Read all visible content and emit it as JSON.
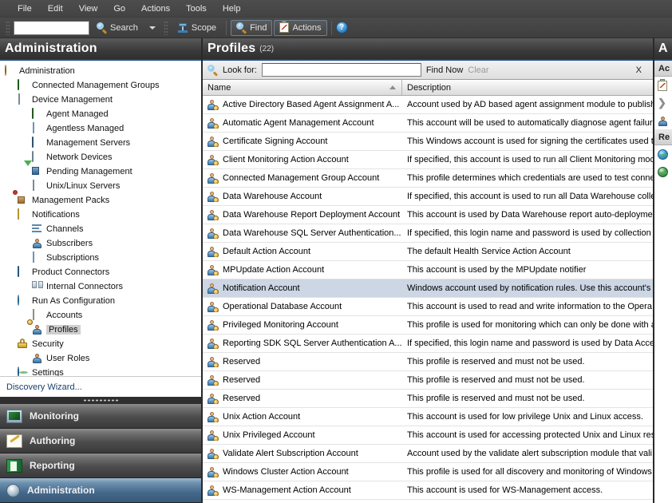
{
  "window": {
    "menu": [
      "File",
      "Edit",
      "View",
      "Go",
      "Actions",
      "Tools",
      "Help"
    ]
  },
  "toolbar": {
    "search_value": "",
    "search_placeholder": "",
    "search_label": "Search",
    "scope_label": "Scope",
    "find_label": "Find",
    "actions_label": "Actions",
    "help_label": "?"
  },
  "sidebar": {
    "title": "Administration",
    "tree": [
      {
        "label": "Administration",
        "indent": 0,
        "icon": "gear-icon",
        "selected": false
      },
      {
        "label": "Connected Management Groups",
        "indent": 1,
        "icon": "connected-groups-icon",
        "selected": false
      },
      {
        "label": "Device Management",
        "indent": 1,
        "icon": "device-management-icon",
        "selected": false
      },
      {
        "label": "Agent Managed",
        "indent": 2,
        "icon": "agent-managed-icon",
        "selected": false
      },
      {
        "label": "Agentless Managed",
        "indent": 2,
        "icon": "agentless-managed-icon",
        "selected": false
      },
      {
        "label": "Management Servers",
        "indent": 2,
        "icon": "management-servers-icon",
        "selected": false
      },
      {
        "label": "Network Devices",
        "indent": 2,
        "icon": "network-devices-icon",
        "selected": false
      },
      {
        "label": "Pending Management",
        "indent": 2,
        "icon": "pending-management-icon",
        "selected": false
      },
      {
        "label": "Unix/Linux Servers",
        "indent": 2,
        "icon": "unix-linux-servers-icon",
        "selected": false
      },
      {
        "label": "Management Packs",
        "indent": 1,
        "icon": "management-packs-icon",
        "selected": false
      },
      {
        "label": "Notifications",
        "indent": 1,
        "icon": "notifications-icon",
        "selected": false
      },
      {
        "label": "Channels",
        "indent": 2,
        "icon": "channels-icon",
        "selected": false
      },
      {
        "label": "Subscribers",
        "indent": 2,
        "icon": "subscribers-icon",
        "selected": false
      },
      {
        "label": "Subscriptions",
        "indent": 2,
        "icon": "subscriptions-icon",
        "selected": false
      },
      {
        "label": "Product Connectors",
        "indent": 1,
        "icon": "product-connectors-icon",
        "selected": false
      },
      {
        "label": "Internal Connectors",
        "indent": 2,
        "icon": "internal-connectors-icon",
        "selected": false
      },
      {
        "label": "Run As Configuration",
        "indent": 1,
        "icon": "run-as-configuration-icon",
        "selected": false
      },
      {
        "label": "Accounts",
        "indent": 2,
        "icon": "accounts-icon",
        "selected": false
      },
      {
        "label": "Profiles",
        "indent": 2,
        "icon": "profiles-icon",
        "selected": true
      },
      {
        "label": "Security",
        "indent": 1,
        "icon": "security-lock-icon",
        "selected": false
      },
      {
        "label": "User Roles",
        "indent": 2,
        "icon": "user-roles-icon",
        "selected": false
      },
      {
        "label": "Settings",
        "indent": 1,
        "icon": "settings-globe-icon",
        "selected": false
      }
    ],
    "discovery_wizard": "Discovery Wizard...",
    "nav_buttons": [
      {
        "label": "Monitoring",
        "icon": "monitoring-icon",
        "active": false
      },
      {
        "label": "Authoring",
        "icon": "authoring-icon",
        "active": false
      },
      {
        "label": "Reporting",
        "icon": "reporting-icon",
        "active": false
      },
      {
        "label": "Administration",
        "icon": "administration-icon",
        "active": true
      }
    ]
  },
  "main": {
    "title": "Profiles",
    "count": "(22)",
    "lookbar": {
      "look_for_label": "Look for:",
      "look_for_value": "",
      "look_for_placeholder": "",
      "find_now_label": "Find Now",
      "clear_label": "Clear",
      "close_label": "X"
    },
    "columns": [
      {
        "label": "Name",
        "sorted": true,
        "sort_dir": "asc"
      },
      {
        "label": "Description",
        "sorted": false,
        "sort_dir": ""
      }
    ],
    "rows": [
      {
        "name": "Active Directory Based Agent Assignment A...",
        "description": "Account used by AD based agent assignment module to publish",
        "selected": false
      },
      {
        "name": "Automatic Agent Management Account",
        "description": "This account will be used to automatically diagnose agent failure",
        "selected": false
      },
      {
        "name": "Certificate Signing Account",
        "description": "This Windows account is used for signing the certificates used t",
        "selected": false
      },
      {
        "name": "Client Monitoring Action Account",
        "description": "If specified, this account is used to run all Client Monitoring mod",
        "selected": false
      },
      {
        "name": "Connected Management Group Account",
        "description": "This profile determines which credentials are used to test conne",
        "selected": false
      },
      {
        "name": "Data Warehouse Account",
        "description": "If specified, this account is used to run all Data Warehouse colle",
        "selected": false
      },
      {
        "name": "Data Warehouse Report Deployment Account",
        "description": "This account is used by Data Warehouse report auto-deployme",
        "selected": false
      },
      {
        "name": "Data Warehouse SQL Server Authentication...",
        "description": "If specified, this login name and password is used by collection",
        "selected": false
      },
      {
        "name": "Default Action Account",
        "description": "The default Health Service Action Account",
        "selected": false
      },
      {
        "name": "MPUpdate Action Account",
        "description": "This account is used by the MPUpdate notifier",
        "selected": false
      },
      {
        "name": "Notification Account",
        "description": "Windows account used by notification rules. Use this account's",
        "selected": true
      },
      {
        "name": "Operational Database Account",
        "description": "This account is used to read and write information to the Opera",
        "selected": false
      },
      {
        "name": "Privileged Monitoring Account",
        "description": "This profile is used for monitoring which can only be done with a",
        "selected": false
      },
      {
        "name": "Reporting SDK SQL Server Authentication A...",
        "description": "If specified, this login name and password is used by Data Acce",
        "selected": false
      },
      {
        "name": "Reserved",
        "description": "This profile is reserved and must not be used.",
        "selected": false
      },
      {
        "name": "Reserved",
        "description": "This profile is reserved and must not be used.",
        "selected": false
      },
      {
        "name": "Reserved",
        "description": "This profile is reserved and must not be used.",
        "selected": false
      },
      {
        "name": "Unix Action Account",
        "description": "This account is used for low privilege Unix and Linux access.",
        "selected": false
      },
      {
        "name": "Unix Privileged Account",
        "description": "This account is used for accessing protected Unix and Linux res",
        "selected": false
      },
      {
        "name": "Validate Alert Subscription Account",
        "description": "Account used by the validate alert subscription module that vali",
        "selected": false
      },
      {
        "name": "Windows Cluster Action Account",
        "description": "This profile is used for all discovery and monitoring of Windows",
        "selected": false
      },
      {
        "name": "WS-Management Action Account",
        "description": "This account is used for WS-Management access.",
        "selected": false
      }
    ]
  },
  "actions_pane": {
    "title": "A",
    "section_actions": "Ac",
    "section_resources": "Re",
    "items": [
      {
        "icon": "clipboard-icon",
        "label": ""
      },
      {
        "icon": "chevron-right-icon",
        "label": ""
      },
      {
        "icon": "person-icon",
        "label": ""
      }
    ],
    "resources": [
      {
        "icon": "globe-blue-icon",
        "label": ""
      },
      {
        "icon": "globe-green-icon",
        "label": ""
      }
    ]
  },
  "colors": {
    "accent_blue": "#1d4d82",
    "selection": "#ccd6e4",
    "chrome_dark": "#3a3a3a",
    "link": "#1b3f6b"
  }
}
